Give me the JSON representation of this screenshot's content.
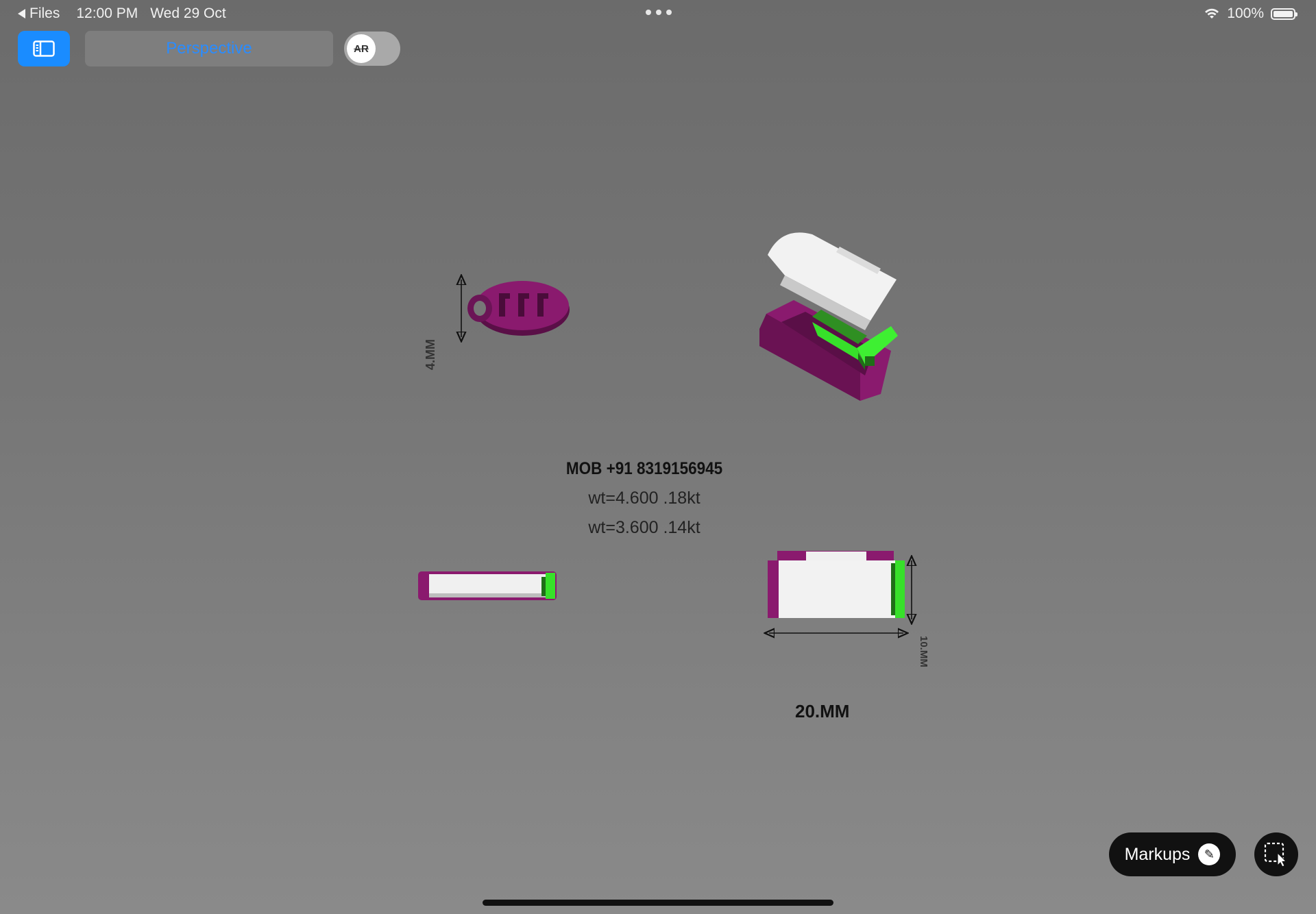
{
  "status_bar": {
    "back_label": "Files",
    "time": "12:00 PM",
    "date": "Wed 29 Oct",
    "battery": "100%"
  },
  "toolbar": {
    "sidebar_icon": "sidebar-icon",
    "view_mode": "Perspective",
    "ar_label": "AR"
  },
  "model": {
    "phone": "MOB +91 8319156945",
    "weight_18kt": "wt=4.600 .18kt",
    "weight_14kt": "wt=3.600 .14kt",
    "dim_height": "4.MM",
    "dim_depth": "10.MM",
    "dim_width": "20.MM"
  },
  "bottom": {
    "markups_label": "Markups",
    "markups_icon": "markup-pen-icon",
    "select_icon": "selection-cursor-icon"
  },
  "colors": {
    "accent": "#1a8cff",
    "model_magenta": "#8a1a6e",
    "model_green": "#37e02a",
    "model_white": "#eeeeee"
  }
}
